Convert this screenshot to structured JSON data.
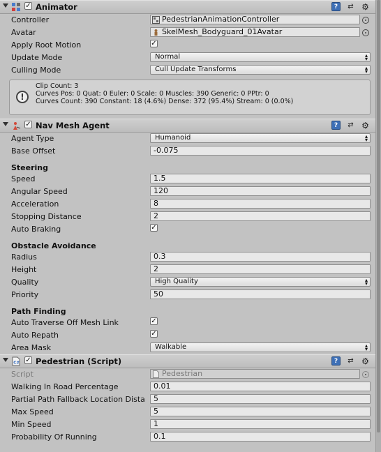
{
  "animator": {
    "title": "Animator",
    "enabled": true,
    "controller": {
      "label": "Controller",
      "value": "PedestrianAnimationController"
    },
    "avatar": {
      "label": "Avatar",
      "value": "SkelMesh_Bodyguard_01Avatar"
    },
    "apply_root_motion": {
      "label": "Apply Root Motion",
      "checked": true
    },
    "update_mode": {
      "label": "Update Mode",
      "value": "Normal"
    },
    "culling_mode": {
      "label": "Culling Mode",
      "value": "Cull Update Transforms"
    },
    "info": {
      "line1": "Clip Count: 3",
      "line2": "Curves Pos: 0 Quat: 0 Euler: 0 Scale: 0 Muscles: 390 Generic: 0 PPtr: 0",
      "line3": "Curves Count: 390 Constant: 18 (4.6%) Dense: 372 (95.4%) Stream: 0 (0.0%)"
    }
  },
  "nav_mesh_agent": {
    "title": "Nav Mesh Agent",
    "enabled": true,
    "agent_type": {
      "label": "Agent Type",
      "value": "Humanoid"
    },
    "base_offset": {
      "label": "Base Offset",
      "value": "-0.075"
    },
    "steering": {
      "title": "Steering",
      "speed": {
        "label": "Speed",
        "value": "1.5"
      },
      "angular_speed": {
        "label": "Angular Speed",
        "value": "120"
      },
      "acceleration": {
        "label": "Acceleration",
        "value": "8"
      },
      "stopping_distance": {
        "label": "Stopping Distance",
        "value": "2"
      },
      "auto_braking": {
        "label": "Auto Braking",
        "checked": true
      }
    },
    "obstacle_avoidance": {
      "title": "Obstacle Avoidance",
      "radius": {
        "label": "Radius",
        "value": "0.3"
      },
      "height": {
        "label": "Height",
        "value": "2"
      },
      "quality": {
        "label": "Quality",
        "value": "High Quality"
      },
      "priority": {
        "label": "Priority",
        "value": "50"
      }
    },
    "path_finding": {
      "title": "Path Finding",
      "auto_traverse": {
        "label": "Auto Traverse Off Mesh Link",
        "checked": true
      },
      "auto_repath": {
        "label": "Auto Repath",
        "checked": true
      },
      "area_mask": {
        "label": "Area Mask",
        "value": "Walkable"
      }
    }
  },
  "pedestrian": {
    "title": "Pedestrian (Script)",
    "enabled": true,
    "script": {
      "label": "Script",
      "value": "Pedestrian"
    },
    "walking_in_road": {
      "label": "Walking In Road Percentage",
      "value": "0.01"
    },
    "partial_path": {
      "label": "Partial Path Fallback Location Dista",
      "value": "5"
    },
    "max_speed": {
      "label": "Max Speed",
      "value": "5"
    },
    "min_speed": {
      "label": "Min Speed",
      "value": "1"
    },
    "probability_running": {
      "label": "Probability Of Running",
      "value": "0.1"
    }
  },
  "icons": {
    "foldout": "foldout-arrow-icon",
    "animator": "animator-component-icon",
    "nav_mesh_agent": "nav-mesh-agent-icon",
    "script": "csharp-script-icon",
    "help": "help-icon",
    "presets": "presets-icon",
    "gear": "gear-icon",
    "object_picker": "object-picker-icon",
    "info": "info-icon"
  },
  "checkmark": "✓"
}
